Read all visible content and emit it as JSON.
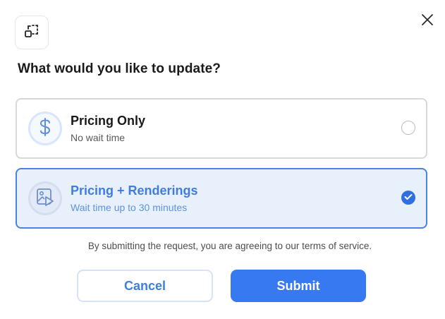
{
  "dialog": {
    "app_icon": "expand-frame-icon",
    "close_icon": "close-icon",
    "title": "What would you like to update?"
  },
  "options": [
    {
      "title": "Pricing Only",
      "subtitle": "No wait time",
      "icon": "dollar-icon",
      "selected": false
    },
    {
      "title": "Pricing + Renderings",
      "subtitle": "Wait time up to 30 minutes",
      "icon": "image-play-icon",
      "selected": true
    }
  ],
  "terms_text": "By submitting the request, you are agreeing to our terms of service.",
  "buttons": {
    "cancel": "Cancel",
    "submit": "Submit"
  },
  "colors": {
    "accent": "#3779f0",
    "selected_bg": "#e8f0fc",
    "selected_border": "#4a83e0"
  }
}
